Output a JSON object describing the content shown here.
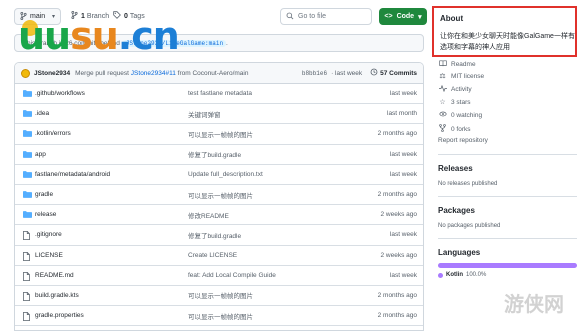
{
  "toolbar": {
    "branch_label": "main",
    "branch_count": "1",
    "branch_word": "Branch",
    "tag_count": "0",
    "tag_word": "Tags",
    "goto_placeholder": "Go to file",
    "code_label": "Code"
  },
  "behind_bar": {
    "text": "This branch is 26 commits behind",
    "ref": "JStone2934/LiveGalGame:main",
    "suffix": "."
  },
  "watermark": {
    "part1": "uu",
    "part2": "su",
    "part3": ".cn",
    "corner": "游侠网"
  },
  "commit": {
    "author": "JStone2934",
    "message_prefix": "Merge pull request",
    "pr_ref": "JStone2934#11",
    "message_suffix": "from Coconut-Aero/main",
    "sha": "b8bb1e6",
    "when": "· last week",
    "count_label": "57 Commits"
  },
  "files": [
    {
      "name": ".github/workflows",
      "type": "folder",
      "message": "test fastlane metadata",
      "date": "last week"
    },
    {
      "name": ".idea",
      "type": "folder",
      "message": "关键词弹窗",
      "date": "last month"
    },
    {
      "name": ".kotlin/errors",
      "type": "folder",
      "message": "可以显示一帧帧的图片",
      "date": "2 months ago"
    },
    {
      "name": "app",
      "type": "folder",
      "message": "修复了build.gradle",
      "date": "last week"
    },
    {
      "name": "fastlane/metadata/android",
      "type": "folder",
      "message": "Update full_description.txt",
      "date": "last week"
    },
    {
      "name": "gradle",
      "type": "folder",
      "message": "可以显示一帧帧的图片",
      "date": "2 months ago"
    },
    {
      "name": "release",
      "type": "folder",
      "message": "修改README",
      "date": "2 weeks ago"
    },
    {
      "name": ".gitignore",
      "type": "file",
      "message": "修复了build.gradle",
      "date": "last week"
    },
    {
      "name": "LICENSE",
      "type": "file",
      "message": "Create LICENSE",
      "date": "2 weeks ago"
    },
    {
      "name": "README.md",
      "type": "file",
      "message": "feat: Add Local Compile Guide",
      "date": "last week"
    },
    {
      "name": "build.gradle.kts",
      "type": "file",
      "message": "可以显示一帧帧的图片",
      "date": "2 months ago"
    },
    {
      "name": "gradle.properties",
      "type": "file",
      "message": "可以显示一帧帧的图片",
      "date": "2 months ago"
    },
    {
      "name": "gradlew",
      "type": "file",
      "message": "可以显示一帧帧的图片",
      "date": "2 months ago"
    }
  ],
  "sidebar": {
    "about_title": "About",
    "about_desc": "让你在和美少女聊天时能像GalGame一样有选项和字幕的神人应用",
    "readme": "Readme",
    "license": "MIT license",
    "activity": "Activity",
    "stars": "3 stars",
    "watching": "0 watching",
    "forks": "0 forks",
    "report": "Report repository",
    "releases_title": "Releases",
    "releases_sub": "No releases published",
    "packages_title": "Packages",
    "packages_sub": "No packages published",
    "languages_title": "Languages",
    "lang_name": "Kotlin",
    "lang_pct": "100.0%",
    "lang_fraction": 1.0
  },
  "colors": {
    "accent_link": "#0969da",
    "code_button": "#1f883d",
    "highlight_border": "#e0312b",
    "kotlin": "#a97bff",
    "folder": "#54aeff"
  }
}
